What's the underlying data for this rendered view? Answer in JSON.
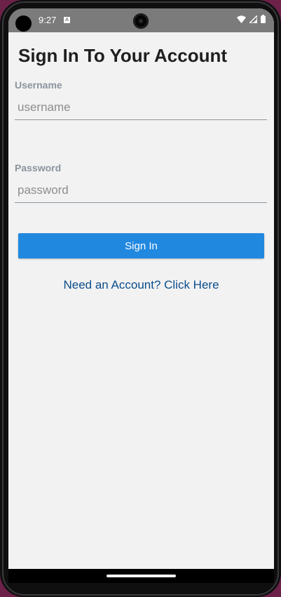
{
  "status_bar": {
    "time": "9:27",
    "notification_icon": "A"
  },
  "form": {
    "title": "Sign In To Your Account",
    "username": {
      "label": "Username",
      "placeholder": "username",
      "value": ""
    },
    "password": {
      "label": "Password",
      "placeholder": "password",
      "value": ""
    },
    "submit_label": "Sign In",
    "signup_link": "Need an Account? Click Here"
  },
  "icons": {
    "status": [
      "wifi-icon",
      "signal-icon",
      "battery-icon"
    ]
  },
  "colors": {
    "accent": "#2188e0",
    "link": "#0b4d8c",
    "background": "#f2f2f2",
    "status_bar": "#7b7b7b"
  }
}
